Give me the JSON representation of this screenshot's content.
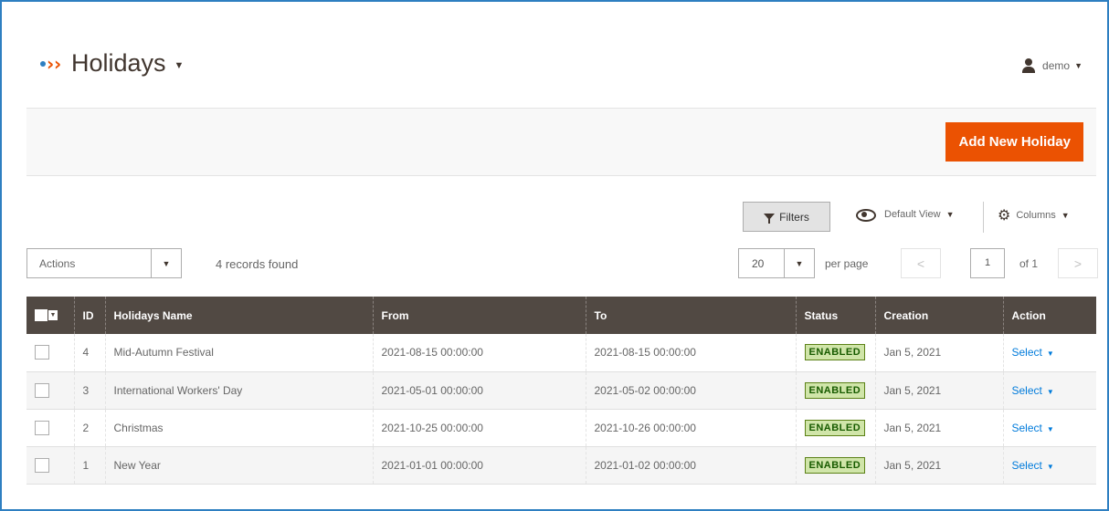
{
  "header": {
    "title": "Holidays",
    "user": "demo"
  },
  "actions_bar": {
    "add_button": "Add New Holiday"
  },
  "toolbar": {
    "filters_label": "Filters",
    "view_label": "Default View",
    "columns_label": "Columns",
    "actions_label": "Actions",
    "records_found": "4 records found",
    "per_page_value": "20",
    "per_page_label": "per page",
    "current_page": "1",
    "page_of": "of 1",
    "prev_glyph": "<",
    "next_glyph": ">"
  },
  "table": {
    "columns": [
      "ID",
      "Holidays Name",
      "From",
      "To",
      "Status",
      "Creation",
      "Action"
    ],
    "rows": [
      {
        "id": "4",
        "name": "Mid-Autumn Festival",
        "from": "2021-08-15 00:00:00",
        "to": "2021-08-15 00:00:00",
        "status": "ENABLED",
        "creation": "Jan 5, 2021",
        "action": "Select"
      },
      {
        "id": "3",
        "name": "International Workers' Day",
        "from": "2021-05-01 00:00:00",
        "to": "2021-05-02 00:00:00",
        "status": "ENABLED",
        "creation": "Jan 5, 2021",
        "action": "Select"
      },
      {
        "id": "2",
        "name": "Christmas",
        "from": "2021-10-25 00:00:00",
        "to": "2021-10-26 00:00:00",
        "status": "ENABLED",
        "creation": "Jan 5, 2021",
        "action": "Select"
      },
      {
        "id": "1",
        "name": "New Year",
        "from": "2021-01-01 00:00:00",
        "to": "2021-01-02 00:00:00",
        "status": "ENABLED",
        "creation": "Jan 5, 2021",
        "action": "Select"
      }
    ]
  },
  "colors": {
    "accent": "#eb5202",
    "header_bg": "#514943",
    "link": "#007bdb",
    "frame": "#2e7fc1"
  }
}
